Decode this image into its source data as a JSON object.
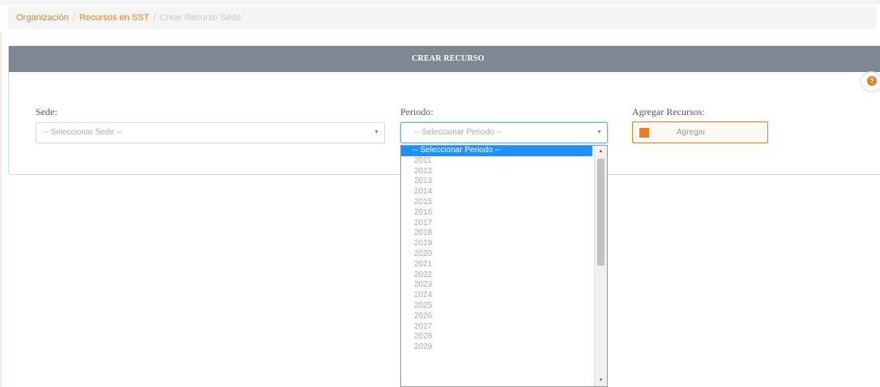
{
  "breadcrumb": {
    "items": [
      "Organización",
      "Recursos en SST"
    ],
    "current": "Crear Recurso Sede"
  },
  "panel": {
    "title": "CREAR RECURSO"
  },
  "help": {
    "icon": "question-icon",
    "glyph": "?"
  },
  "sede": {
    "label": "Sede:",
    "placeholder": "-- Seleccionar Sede --"
  },
  "periodo": {
    "label": "Periodo:",
    "placeholder": "-- Seleccionar Periodo --",
    "options": [
      "-- Seleccionar Periodo --",
      "2011",
      "2012",
      "2013",
      "2014",
      "2015",
      "2016",
      "2017",
      "2018",
      "2019",
      "2020",
      "2021",
      "2022",
      "2023",
      "2024",
      "2025",
      "2026",
      "2027",
      "2028",
      "2029"
    ],
    "selected_index": 0
  },
  "agregar": {
    "label": "Agregar Recursos:",
    "button_label": "Agregar",
    "icon": "edit-icon"
  },
  "colors": {
    "accent": "#e67e22",
    "header_bg": "#7d8892",
    "selection": "#1e90ff"
  }
}
